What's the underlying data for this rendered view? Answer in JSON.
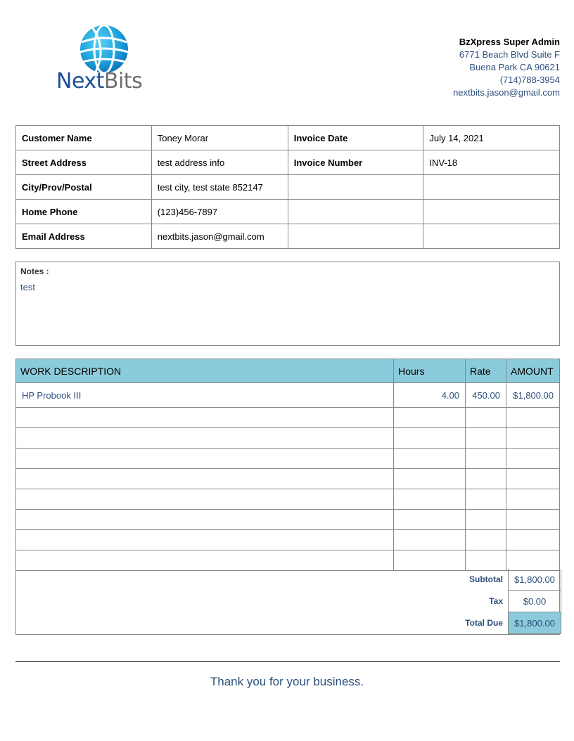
{
  "brand": {
    "name_part1": "Next",
    "name_part2": "Bits",
    "accent": "#1b4f97",
    "globe_color": "#1aa3dd"
  },
  "company": {
    "name": "BzXpress Super Admin",
    "address1": "6771 Beach Blvd Suite F",
    "address2": "Buena Park CA 90621",
    "phone": "(714)788-3954",
    "email": "nextbits.jason@gmail.com"
  },
  "info": {
    "customer_name_label": "Customer Name",
    "customer_name": "Toney Morar",
    "street_label": "Street Address",
    "street": "test address info",
    "city_label": "City/Prov/Postal",
    "city": "test city, test state 852147",
    "phone_label": "Home Phone",
    "phone": "(123)456-7897",
    "email_label": "Email Address",
    "email": "nextbits.jason@gmail.com",
    "invoice_date_label": "Invoice Date",
    "invoice_date": "July 14, 2021",
    "invoice_number_label": "Invoice Number",
    "invoice_number": "INV-18"
  },
  "notes": {
    "label": "Notes :",
    "text": "test"
  },
  "work": {
    "headers": [
      "WORK DESCRIPTION",
      "Hours",
      "Rate",
      "AMOUNT"
    ],
    "items": [
      {
        "description": "HP Probook III",
        "hours": "4.00",
        "rate": "450.00",
        "amount": "$1,800.00"
      }
    ],
    "header_color": "#8ccbdb"
  },
  "totals": {
    "subtotal_label": "Subtotal",
    "subtotal": "$1,800.00",
    "tax_label": "Tax",
    "tax": "$0.00",
    "total_label": "Total Due",
    "total": "$1,800.00"
  },
  "footer": {
    "thanks": "Thank you for your business."
  }
}
